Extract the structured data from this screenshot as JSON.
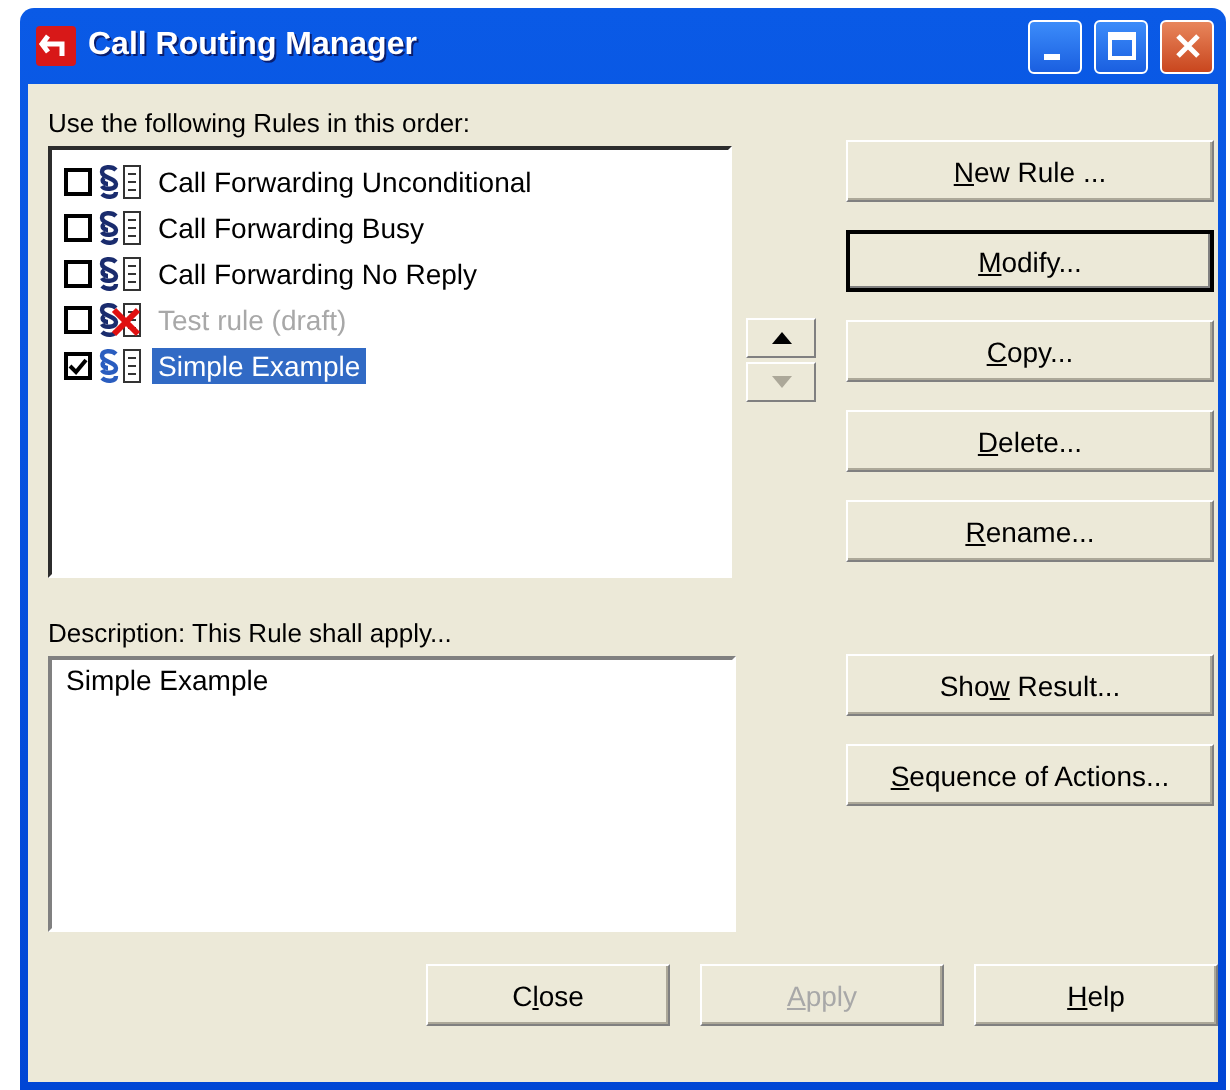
{
  "window": {
    "title": "Call Routing Manager"
  },
  "rules_label": "Use the following Rules in this order:",
  "rules": [
    {
      "label": "Call Forwarding Unconditional",
      "checked": false,
      "selected": false,
      "disabled": false
    },
    {
      "label": "Call Forwarding Busy",
      "checked": false,
      "selected": false,
      "disabled": false
    },
    {
      "label": "Call Forwarding No Reply",
      "checked": false,
      "selected": false,
      "disabled": false
    },
    {
      "label": "Test rule (draft)",
      "checked": false,
      "selected": false,
      "disabled": true
    },
    {
      "label": "Simple Example",
      "checked": true,
      "selected": true,
      "disabled": false
    }
  ],
  "move_buttons": [
    {
      "kind": "up",
      "disabled": false
    },
    {
      "kind": "down",
      "disabled": true
    }
  ],
  "rule_buttons": [
    {
      "key": "N",
      "after": "ew Rule ...",
      "default": false
    },
    {
      "key": "M",
      "after": "odify...",
      "default": true
    },
    {
      "key": "C",
      "after": "opy...",
      "default": false
    },
    {
      "key": "D",
      "after": "elete...",
      "default": false
    },
    {
      "key": "R",
      "after": "ename...",
      "default": false
    }
  ],
  "description_label": "Description: This Rule shall apply...",
  "description": "Simple Example",
  "detail_buttons": [
    {
      "before": "Sho",
      "key": "w",
      "after": " Result..."
    },
    {
      "key": "S",
      "after": "equence of Actions..."
    }
  ],
  "footer_buttons": [
    {
      "before": "C",
      "key": "l",
      "after": "ose",
      "disabled": false
    },
    {
      "key": "A",
      "after": "pply",
      "disabled": true
    },
    {
      "key": "H",
      "after": "elp",
      "disabled": false
    }
  ]
}
